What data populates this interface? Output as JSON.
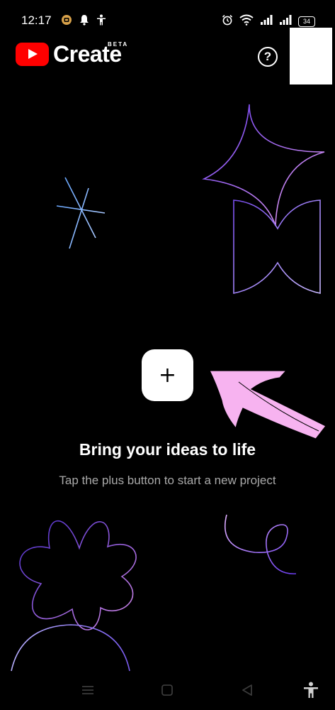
{
  "status_bar": {
    "time": "12:17",
    "battery": "34",
    "left_icons": [
      "notification-app-icon",
      "bell-icon",
      "accessibility-icon"
    ],
    "right_icons": [
      "alarm-icon",
      "wifi-icon",
      "signal-icon",
      "signal-icon",
      "battery-icon"
    ]
  },
  "header": {
    "app_name": "Create",
    "beta_label": "BETA",
    "help_label": "?"
  },
  "main": {
    "plus_label": "+",
    "headline": "Bring your ideas to life",
    "subline": "Tap the plus button to start a new project"
  },
  "nav_bar": {
    "items": [
      "menu-icon",
      "home-square-icon",
      "back-triangle-icon",
      "accessibility-icon"
    ]
  },
  "colors": {
    "background": "#000000",
    "brand_red": "#ff0000",
    "annotation_pink": "#f7b3f0",
    "decor_purple": "#8a5cf5",
    "subtext_gray": "#a9a9a9"
  }
}
